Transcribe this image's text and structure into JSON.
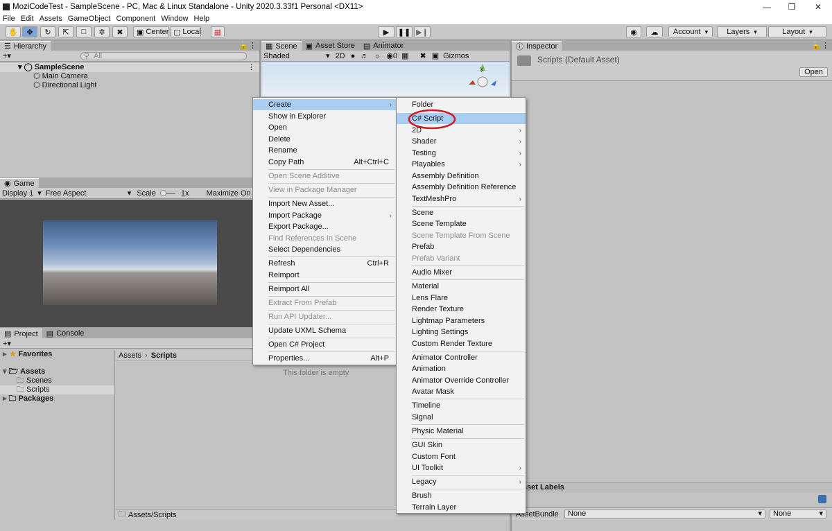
{
  "window": {
    "title": "MoziCodeTest - SampleScene - PC, Mac & Linux Standalone - Unity 2020.3.33f1 Personal <DX11>"
  },
  "menubar": [
    "File",
    "Edit",
    "Assets",
    "GameObject",
    "Component",
    "Window",
    "Help"
  ],
  "toolbar": {
    "center_label": "Center",
    "local_label": "Local",
    "account_label": "Account",
    "layers_label": "Layers",
    "layout_label": "Layout"
  },
  "hierarchy": {
    "tab": "Hierarchy",
    "search_placeholder": "All",
    "scene": "SampleScene",
    "objects": [
      "Main Camera",
      "Directional Light"
    ]
  },
  "scene_view": {
    "tabs": [
      "Scene",
      "Asset Store",
      "Animator"
    ],
    "shading": "Shaded",
    "mode_2d": "2D",
    "hidden_count": "0",
    "gizmos": "Gizmos",
    "axis_label": "y"
  },
  "game_view": {
    "tab": "Game",
    "display": "Display 1",
    "aspect": "Free Aspect",
    "scale_label": "Scale",
    "scale_value": "1x",
    "maximize": "Maximize On Pl"
  },
  "inspector": {
    "tab": "Inspector",
    "asset_title": "Scripts (Default Asset)",
    "open_button": "Open",
    "asset_labels": "Asset Labels",
    "assetbundle_label": "AssetBundle",
    "assetbundle_value": "None",
    "variant_value": "None"
  },
  "project": {
    "tabs": [
      "Project",
      "Console"
    ],
    "favorites": "Favorites",
    "assets": "Assets",
    "folders": [
      "Scenes",
      "Scripts"
    ],
    "packages": "Packages",
    "breadcrumb_root": "Assets",
    "breadcrumb_current": "Scripts",
    "empty_message": "This folder is empty",
    "footer_path": "Assets/Scripts"
  },
  "context_menu": {
    "items": [
      {
        "label": "Create",
        "arrow": true,
        "highlighted": true
      },
      {
        "label": "Show in Explorer"
      },
      {
        "label": "Open"
      },
      {
        "label": "Delete"
      },
      {
        "label": "Rename"
      },
      {
        "label": "Copy Path",
        "shortcut": "Alt+Ctrl+C"
      },
      {
        "label": "Open Scene Additive",
        "disabled": true
      },
      {
        "label": "View in Package Manager",
        "disabled": true
      },
      {
        "label": "Import New Asset..."
      },
      {
        "label": "Import Package",
        "arrow": true
      },
      {
        "label": "Export Package..."
      },
      {
        "label": "Find References In Scene",
        "disabled": true
      },
      {
        "label": "Select Dependencies"
      },
      {
        "label": "Refresh",
        "shortcut": "Ctrl+R"
      },
      {
        "label": "Reimport"
      },
      {
        "label": "Reimport All"
      },
      {
        "label": "Extract From Prefab",
        "disabled": true
      },
      {
        "label": "Run API Updater...",
        "disabled": true
      },
      {
        "label": "Update UXML Schema"
      },
      {
        "label": "Open C# Project"
      },
      {
        "label": "Properties...",
        "shortcut": "Alt+P"
      }
    ]
  },
  "create_submenu": {
    "items": [
      {
        "label": "Folder"
      },
      {
        "label": "C# Script",
        "highlighted": true
      },
      {
        "label": "2D",
        "arrow": true
      },
      {
        "label": "Shader",
        "arrow": true
      },
      {
        "label": "Testing",
        "arrow": true
      },
      {
        "label": "Playables",
        "arrow": true
      },
      {
        "label": "Assembly Definition"
      },
      {
        "label": "Assembly Definition Reference"
      },
      {
        "label": "TextMeshPro",
        "arrow": true
      },
      {
        "label": "Scene"
      },
      {
        "label": "Scene Template"
      },
      {
        "label": "Scene Template From Scene",
        "disabled": true
      },
      {
        "label": "Prefab"
      },
      {
        "label": "Prefab Variant",
        "disabled": true
      },
      {
        "label": "Audio Mixer"
      },
      {
        "label": "Material"
      },
      {
        "label": "Lens Flare"
      },
      {
        "label": "Render Texture"
      },
      {
        "label": "Lightmap Parameters"
      },
      {
        "label": "Lighting Settings"
      },
      {
        "label": "Custom Render Texture"
      },
      {
        "label": "Animator Controller"
      },
      {
        "label": "Animation"
      },
      {
        "label": "Animator Override Controller"
      },
      {
        "label": "Avatar Mask"
      },
      {
        "label": "Timeline"
      },
      {
        "label": "Signal"
      },
      {
        "label": "Physic Material"
      },
      {
        "label": "GUI Skin"
      },
      {
        "label": "Custom Font"
      },
      {
        "label": "UI Toolkit",
        "arrow": true
      },
      {
        "label": "Legacy",
        "arrow": true
      },
      {
        "label": "Brush"
      },
      {
        "label": "Terrain Layer"
      }
    ]
  },
  "colors": {
    "menu_highlight": "#aacdf2",
    "annotation_circle": "#d0181e"
  }
}
